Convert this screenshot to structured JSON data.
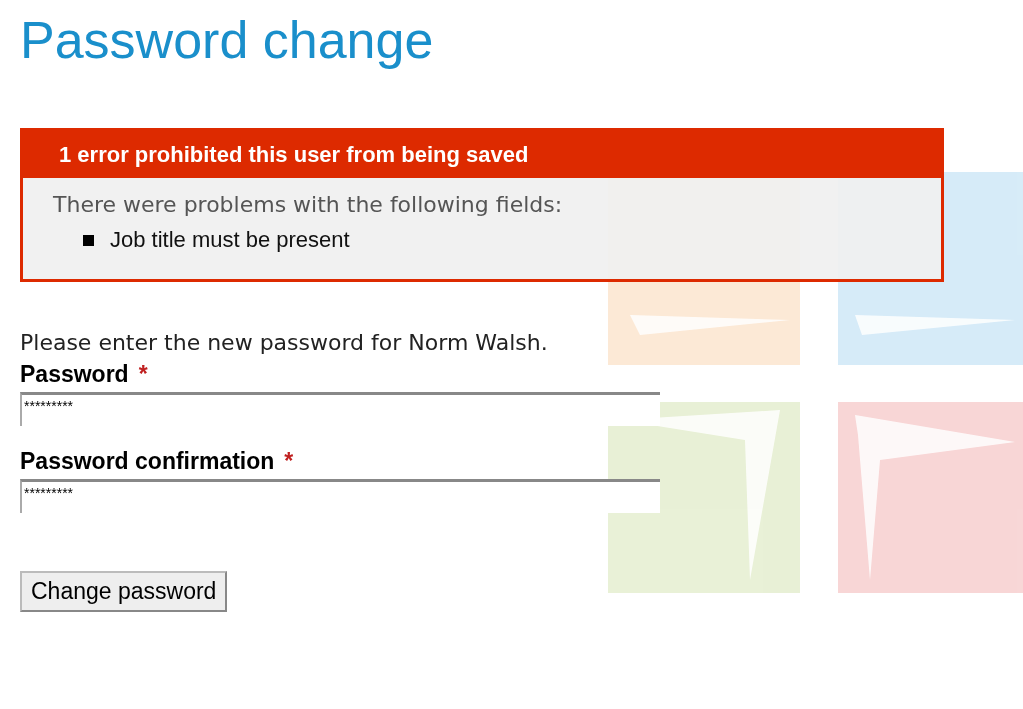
{
  "title": "Password change",
  "error_box": {
    "heading": "1 error prohibited this user from being saved",
    "intro": "There were problems with the following fields:",
    "errors": [
      "Job title must be present"
    ]
  },
  "instructions": "Please enter the new password for Norm Walsh.",
  "fields": [
    {
      "label": "Password",
      "required_mark": "*",
      "value": "*********"
    },
    {
      "label": "Password confirmation",
      "required_mark": "*",
      "value": "*********"
    }
  ],
  "submit_button": "Change password"
}
